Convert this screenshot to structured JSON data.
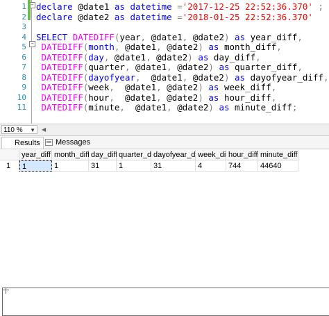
{
  "editor": {
    "line_numbers": [
      "1",
      "2",
      "3",
      "4",
      "5",
      "6",
      "7",
      "8",
      "9",
      "10",
      "11"
    ],
    "lines": [
      [
        {
          "t": "declare ",
          "c": "kw"
        },
        {
          "t": "@date1 ",
          "c": ""
        },
        {
          "t": "as ",
          "c": "kw"
        },
        {
          "t": "datetime ",
          "c": "kw"
        },
        {
          "t": "=",
          "c": "op"
        },
        {
          "t": "'2017-12-25 22:52:36.370'",
          "c": "str"
        },
        {
          "t": " ;",
          "c": "op"
        }
      ],
      [
        {
          "t": "declare ",
          "c": "kw"
        },
        {
          "t": "@date2 ",
          "c": ""
        },
        {
          "t": "as ",
          "c": "kw"
        },
        {
          "t": "datetime ",
          "c": "kw"
        },
        {
          "t": "=",
          "c": "op"
        },
        {
          "t": "'2018-01-25 22:52:36.370'",
          "c": "str"
        }
      ],
      [],
      [
        {
          "t": "SELECT ",
          "c": "kw"
        },
        {
          "t": "DATEDIFF",
          "c": "fn"
        },
        {
          "t": "(",
          "c": "op"
        },
        {
          "t": "year",
          "c": ""
        },
        {
          "t": ", ",
          "c": "op"
        },
        {
          "t": "@date1",
          "c": ""
        },
        {
          "t": ", ",
          "c": "op"
        },
        {
          "t": "@date2",
          "c": ""
        },
        {
          "t": ") ",
          "c": "op"
        },
        {
          "t": "as ",
          "c": "kw"
        },
        {
          "t": "year_diff",
          "c": ""
        },
        {
          "t": ",",
          "c": "op"
        }
      ],
      [
        {
          "t": " DATEDIFF",
          "c": "fn"
        },
        {
          "t": "(",
          "c": "op"
        },
        {
          "t": "month",
          "c": "kw"
        },
        {
          "t": ", ",
          "c": "op"
        },
        {
          "t": "@date1",
          "c": ""
        },
        {
          "t": ", ",
          "c": "op"
        },
        {
          "t": "@date2",
          "c": ""
        },
        {
          "t": ") ",
          "c": "op"
        },
        {
          "t": "as ",
          "c": "kw"
        },
        {
          "t": "month_diff",
          "c": ""
        },
        {
          "t": ",",
          "c": "op"
        }
      ],
      [
        {
          "t": " DATEDIFF",
          "c": "fn"
        },
        {
          "t": "(",
          "c": "op"
        },
        {
          "t": "day",
          "c": "kw"
        },
        {
          "t": ", ",
          "c": "op"
        },
        {
          "t": "@date1",
          "c": ""
        },
        {
          "t": ", ",
          "c": "op"
        },
        {
          "t": "@date2",
          "c": ""
        },
        {
          "t": ") ",
          "c": "op"
        },
        {
          "t": "as ",
          "c": "kw"
        },
        {
          "t": "day_diff",
          "c": ""
        },
        {
          "t": ",",
          "c": "op"
        }
      ],
      [
        {
          "t": " DATEDIFF",
          "c": "fn"
        },
        {
          "t": "(",
          "c": "op"
        },
        {
          "t": "quarter",
          "c": ""
        },
        {
          "t": ", ",
          "c": "op"
        },
        {
          "t": "@date1",
          "c": ""
        },
        {
          "t": ", ",
          "c": "op"
        },
        {
          "t": "@date2",
          "c": ""
        },
        {
          "t": ") ",
          "c": "op"
        },
        {
          "t": "as ",
          "c": "kw"
        },
        {
          "t": "quarter_diff",
          "c": ""
        },
        {
          "t": ",",
          "c": "op"
        }
      ],
      [
        {
          "t": " DATEDIFF",
          "c": "fn"
        },
        {
          "t": "(",
          "c": "op"
        },
        {
          "t": "dayofyear",
          "c": "kw"
        },
        {
          "t": ",  ",
          "c": "op"
        },
        {
          "t": "@date1",
          "c": ""
        },
        {
          "t": ", ",
          "c": "op"
        },
        {
          "t": "@date2",
          "c": ""
        },
        {
          "t": ") ",
          "c": "op"
        },
        {
          "t": "as ",
          "c": "kw"
        },
        {
          "t": "dayofyear_diff",
          "c": ""
        },
        {
          "t": ",",
          "c": "op"
        }
      ],
      [
        {
          "t": " DATEDIFF",
          "c": "fn"
        },
        {
          "t": "(",
          "c": "op"
        },
        {
          "t": "week",
          "c": ""
        },
        {
          "t": ",  ",
          "c": "op"
        },
        {
          "t": "@date1",
          "c": ""
        },
        {
          "t": ", ",
          "c": "op"
        },
        {
          "t": "@date2",
          "c": ""
        },
        {
          "t": ") ",
          "c": "op"
        },
        {
          "t": "as ",
          "c": "kw"
        },
        {
          "t": "week_diff",
          "c": ""
        },
        {
          "t": ",",
          "c": "op"
        }
      ],
      [
        {
          "t": " DATEDIFF",
          "c": "fn"
        },
        {
          "t": "(",
          "c": "op"
        },
        {
          "t": "hour",
          "c": ""
        },
        {
          "t": ",  ",
          "c": "op"
        },
        {
          "t": "@date1",
          "c": ""
        },
        {
          "t": ", ",
          "c": "op"
        },
        {
          "t": "@date2",
          "c": ""
        },
        {
          "t": ") ",
          "c": "op"
        },
        {
          "t": "as ",
          "c": "kw"
        },
        {
          "t": "hour_diff",
          "c": ""
        },
        {
          "t": ",",
          "c": "op"
        }
      ],
      [
        {
          "t": " DATEDIFF",
          "c": "fn"
        },
        {
          "t": "(",
          "c": "op"
        },
        {
          "t": "minute",
          "c": ""
        },
        {
          "t": ",  ",
          "c": "op"
        },
        {
          "t": "@date1",
          "c": ""
        },
        {
          "t": ", ",
          "c": "op"
        },
        {
          "t": "@date2",
          "c": ""
        },
        {
          "t": ") ",
          "c": "op"
        },
        {
          "t": "as ",
          "c": "kw"
        },
        {
          "t": "minute_diff",
          "c": ""
        },
        {
          "t": ";",
          "c": "op"
        }
      ]
    ]
  },
  "status": {
    "zoom": "110 %"
  },
  "tabs": {
    "results": "Results",
    "messages": "Messages"
  },
  "grid": {
    "columns": [
      "year_diff",
      "month_diff",
      "day_diff",
      "quarter_diff",
      "dayofyear_diff",
      "week_diff",
      "hour_diff",
      "minute_diff"
    ],
    "row_number": "1",
    "values": [
      "1",
      "1",
      "31",
      "1",
      "31",
      "4",
      "744",
      "44640"
    ]
  }
}
